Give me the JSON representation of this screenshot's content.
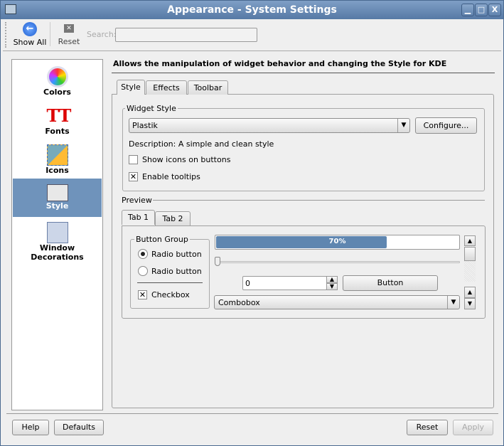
{
  "window": {
    "title": "Appearance - System Settings",
    "minimize": "▁",
    "maximize": "□",
    "close": "X"
  },
  "toolbar": {
    "show_all": "Show All",
    "reset": "Reset",
    "search_label": "Search:",
    "search_value": ""
  },
  "sidebar": {
    "items": [
      {
        "label": "Colors",
        "icon": "colors-icon"
      },
      {
        "label": "Fonts",
        "icon": "fonts-icon"
      },
      {
        "label": "Icons",
        "icon": "icons-icon"
      },
      {
        "label": "Style",
        "icon": "style-icon",
        "selected": true
      },
      {
        "label": "Window Decorations",
        "icon": "window-decorations-icon"
      }
    ]
  },
  "main": {
    "header": "Allows the manipulation of widget behavior and changing the Style for KDE",
    "tabs": [
      {
        "label": "Style",
        "active": true
      },
      {
        "label": "Effects"
      },
      {
        "label": "Toolbar"
      }
    ],
    "widget_style": {
      "group_label": "Widget Style",
      "selected": "Plastik",
      "configure": "Configure...",
      "description": "Description: A simple and clean style",
      "show_icons": "Show icons on buttons",
      "show_icons_checked": false,
      "enable_tooltips": "Enable tooltips",
      "enable_tooltips_checked": true
    },
    "preview": {
      "label": "Preview",
      "tabs": [
        {
          "label": "Tab 1",
          "active": true
        },
        {
          "label": "Tab 2"
        }
      ],
      "button_group": "Button Group",
      "radio1": "Radio button",
      "radio2": "Radio button",
      "checkbox": "Checkbox",
      "progress": 70,
      "progress_text": "70%",
      "spin_value": "0",
      "button": "Button",
      "combobox": "Combobox"
    }
  },
  "footer": {
    "help": "Help",
    "defaults": "Defaults",
    "reset": "Reset",
    "apply": "Apply"
  },
  "colors": {
    "titlebar": "#5679a5",
    "selection": "#6f93bb",
    "progress": "#5f86b0"
  }
}
